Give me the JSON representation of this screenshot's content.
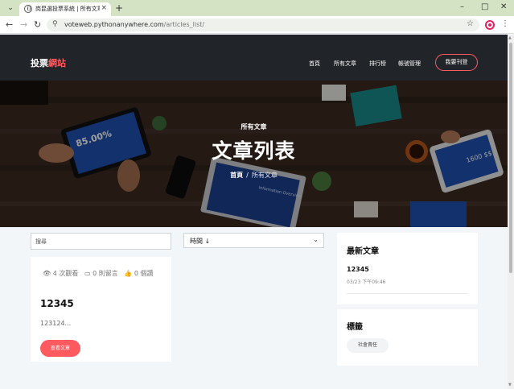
{
  "browser": {
    "tab_title": "岗昆選投票系統 | 所有文章",
    "url_host": "voteweb.pythonanywhere.com",
    "url_path": "/articles_list/"
  },
  "site": {
    "brand_main": "投票",
    "brand_accent": "網站",
    "nav": [
      "首頁",
      "所有文章",
      "排行榜",
      "帳號管理"
    ],
    "cta": "我要刊登"
  },
  "hero": {
    "subtitle": "所有文章",
    "title": "文章列表",
    "breadcrumb_home": "首頁",
    "breadcrumb_sep": "/",
    "breadcrumb_current": "所有文章",
    "tablet_left_text": "85.00%",
    "tablet_right_text": "1600 $$",
    "laptop_text": "Information Overview"
  },
  "filters": {
    "search_placeholder": "搜尋",
    "sort_value": "時間 ↓"
  },
  "article": {
    "views": "4 次觀看",
    "comments": "0 則留言",
    "likes": "0 個讚",
    "title": "12345",
    "excerpt": "123124...",
    "read_button": "查看文章"
  },
  "sidebar": {
    "latest_heading": "最新文章",
    "latest_title": "12345",
    "latest_date": "03/23 下午09:46",
    "tags_heading": "標籤",
    "tag": "社會責任"
  },
  "colors": {
    "accent": "#ff5a5f",
    "nav_bg": "#212428",
    "page_bg": "#f3f6f8",
    "tab_strip": "#d3e3c4"
  }
}
